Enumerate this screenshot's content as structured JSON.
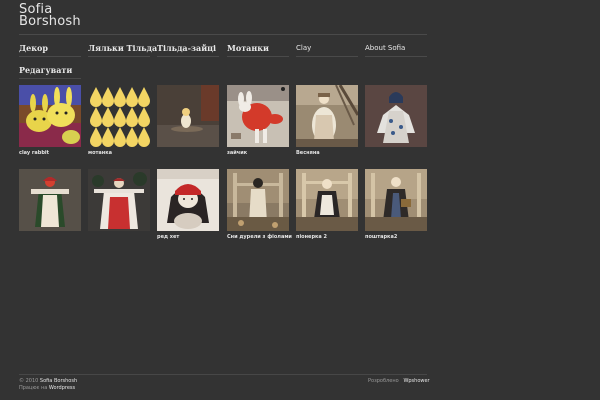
{
  "site": {
    "title_line1": "Sofia",
    "title_line2": "Borshosh"
  },
  "nav": {
    "row1": [
      {
        "label": "Декор"
      },
      {
        "label": "Ляльки Тільда"
      },
      {
        "label": "Тільда-зайці"
      },
      {
        "label": "Мотанки"
      },
      {
        "label": "Clay"
      },
      {
        "label": "About Sofia"
      }
    ],
    "row2": [
      {
        "label": "Редагувати"
      }
    ]
  },
  "gallery": [
    {
      "caption": "clay rabbit",
      "icon": "yellow-clay-rabbits-photo"
    },
    {
      "caption": "мотанка",
      "icon": "yellow-droplets-pattern"
    },
    {
      "caption": "",
      "icon": "dim-room-doll-photo"
    },
    {
      "caption": "зайчик",
      "icon": "red-bunny-photo"
    },
    {
      "caption": "Весняна",
      "icon": "spring-doll-photo"
    },
    {
      "caption": "",
      "icon": "floral-dress-doll-photo"
    },
    {
      "caption": "",
      "icon": "red-hat-motanka-photo"
    },
    {
      "caption": "",
      "icon": "red-white-motanka-photo"
    },
    {
      "caption": "ред хет",
      "icon": "red-hat-doll-photo"
    },
    {
      "caption": "Сни дурели з фіолами",
      "icon": "doll-on-chair-photo"
    },
    {
      "caption": "піонерка 2",
      "icon": "pioneer-doll-photo"
    },
    {
      "caption": "поштарка2",
      "icon": "postwoman-doll-photo"
    }
  ],
  "footer": {
    "copyright": "© 2010",
    "owner": "Sofia Borshosh",
    "powered_prefix": "Працює на",
    "powered_link": "Wordpress",
    "developed_prefix": "Розроблено",
    "developed_link": "Wpshower"
  },
  "colors": {
    "background": "#333333",
    "accent_text": "#e6e6e6",
    "rule": "#4a4a4a"
  }
}
